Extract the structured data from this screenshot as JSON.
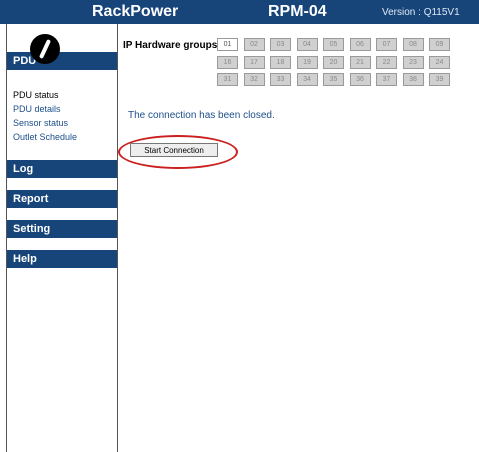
{
  "header": {
    "brand": "RackPower",
    "model": "RPM-04",
    "version": "Version : Q115V1"
  },
  "sidebar": {
    "pdu_head": "PDU",
    "items": [
      "PDU status",
      "PDU details",
      "Sensor status",
      "Outlet Schedule"
    ],
    "sections": [
      "Log",
      "Report",
      "Setting",
      "Help"
    ]
  },
  "ip_groups": {
    "label": "IP Hardware groups",
    "row1": [
      "01",
      "02",
      "03",
      "04",
      "05",
      "06",
      "07",
      "08",
      "09"
    ],
    "row2": [
      "16",
      "17",
      "18",
      "19",
      "20",
      "21",
      "22",
      "23",
      "24"
    ],
    "row3": [
      "31",
      "32",
      "33",
      "34",
      "35",
      "36",
      "37",
      "38",
      "39"
    ]
  },
  "main": {
    "message": "The connection has been closed.",
    "button_label": "Start Connection"
  },
  "colors": {
    "header": "#17457a",
    "link": "#1c4f8a",
    "highlight_oval": "#cc2020"
  }
}
